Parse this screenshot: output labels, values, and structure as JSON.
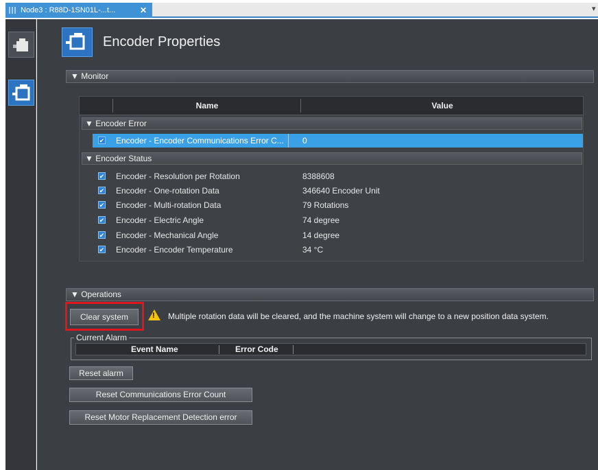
{
  "tab": {
    "title": "Node3 : R88D-1SN01L-...t...",
    "close": "✕",
    "more": "▾"
  },
  "header": {
    "title": "Encoder Properties"
  },
  "monitor": {
    "label": "▼ Monitor",
    "columns": {
      "name": "Name",
      "value": "Value"
    },
    "groups": [
      {
        "label": "▼ Encoder Error",
        "rows": [
          {
            "check": "✔",
            "name": "Encoder - Encoder Communications Error C...",
            "value": "0",
            "selected": true
          }
        ]
      },
      {
        "label": "▼ Encoder Status",
        "rows": [
          {
            "check": "✔",
            "name": "Encoder - Resolution per Rotation",
            "value": "8388608"
          },
          {
            "check": "✔",
            "name": "Encoder - One-rotation Data",
            "value": "346640 Encoder Unit"
          },
          {
            "check": "✔",
            "name": "Encoder - Multi-rotation Data",
            "value": "79 Rotations"
          },
          {
            "check": "✔",
            "name": "Encoder - Electric Angle",
            "value": "74 degree"
          },
          {
            "check": "✔",
            "name": "Encoder - Mechanical Angle",
            "value": "14 degree"
          },
          {
            "check": "✔",
            "name": "Encoder - Encoder Temperature",
            "value": "34 °C"
          }
        ]
      }
    ]
  },
  "operations": {
    "label": "▼ Operations",
    "clear_system": "Clear system",
    "warning_mark": "!",
    "warning_text": "Multiple rotation data will be cleared, and the machine system will change to a new position data system.",
    "current_alarm": {
      "label": "Current Alarm",
      "col_event": "Event Name",
      "col_error": "Error Code"
    },
    "reset_alarm": "Reset alarm",
    "reset_comm": "Reset Communications Error Count",
    "reset_motor": "Reset Motor Replacement Detection error"
  }
}
